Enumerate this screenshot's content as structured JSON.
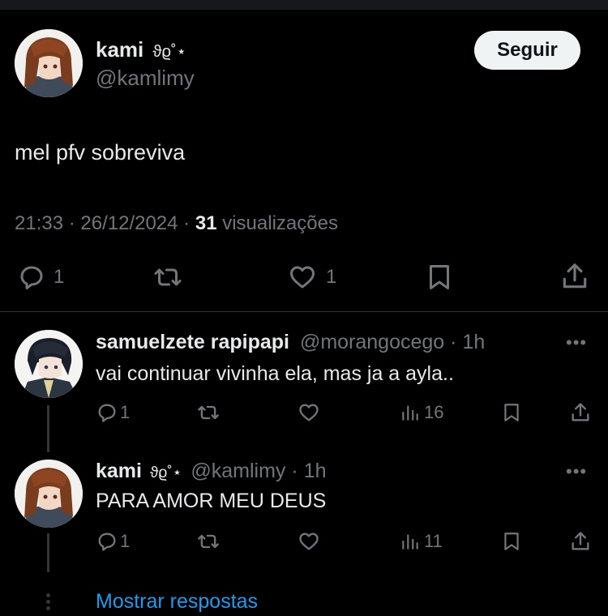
{
  "main_post": {
    "display_name": "kami",
    "name_decoration": "ϑϱ˚⋆",
    "handle": "@kamlimy",
    "follow_label": "Seguir",
    "text": "mel pfv sobreviva",
    "timestamp": "21:33 · 26/12/2024 ·",
    "views_count": "31",
    "views_label": "visualizações",
    "reply_count": "1",
    "like_count": "1"
  },
  "replies": [
    {
      "display_name": "samuelzete rapipapi",
      "handle": "@morangocego",
      "time": "· 1h",
      "text": "vai continuar vivinha ela, mas ja a ayla..",
      "reply_count": "1",
      "view_count": "16"
    },
    {
      "display_name": "kami",
      "name_decoration": "ϑϱ˚⋆",
      "handle": "@kamlimy",
      "time": "· 1h",
      "text": "PARA AMOR MEU DEUS",
      "reply_count": "1",
      "view_count": "11"
    }
  ],
  "show_replies_label": "Mostrar respostas",
  "colors": {
    "background": "#000000",
    "text": "#e7e9ea",
    "muted": "#71767b",
    "link": "#1d9bf0",
    "button_bg": "#eff3f4",
    "divider": "#2f3336"
  },
  "icons": [
    "reply-icon",
    "retweet-icon",
    "like-icon",
    "bookmark-icon",
    "share-icon",
    "views-icon",
    "more-icon"
  ]
}
